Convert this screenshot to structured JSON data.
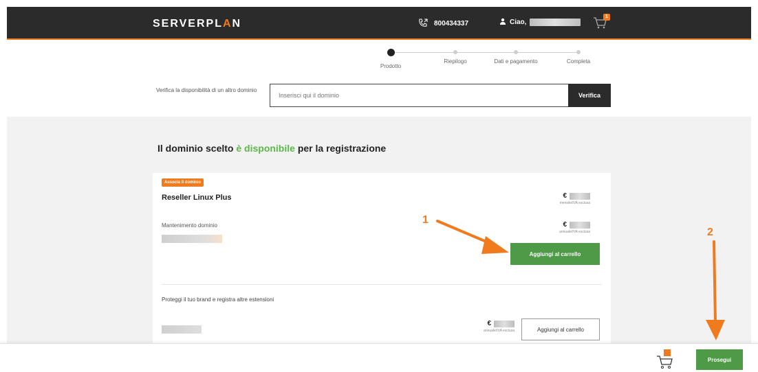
{
  "header": {
    "logo": {
      "part1": "SERVER",
      "part2": "PL",
      "part3": "A",
      "part4": "N"
    },
    "phone": "800434337",
    "greeting": "Ciao,",
    "cart_count": "1",
    "accent": "#f07b1e",
    "bg": "#2b2b2b"
  },
  "stepper": {
    "steps": [
      {
        "label": "Prodotto",
        "active": true
      },
      {
        "label": "Riepilogo",
        "active": false
      },
      {
        "label": "Dati e pagamento",
        "active": false
      },
      {
        "label": "Completa",
        "active": false
      }
    ]
  },
  "verify": {
    "label": "Verifica la disponibilità di un altro dominio",
    "placeholder": "Inserisci qui il dominio",
    "button": "Verifica"
  },
  "main": {
    "headline_pre": "Il dominio scelto ",
    "headline_highlight": "è disponibile",
    "headline_post": " per la registrazione",
    "card": {
      "tag": "Associa il dominio",
      "product_name": "Reseller Linux Plus",
      "product_price_sub": "mensile/IVA esclusa",
      "maintenance_label": "Mantenimento dominio",
      "maintenance_price_sub": "annuale/IVA esclusa",
      "add_button": "Aggiungi al carrello",
      "protect_text": "Proteggi il tuo brand e registra altre estensioni",
      "ext_price_sub": "annuale/IVA esclusa",
      "ext_add_button": "Aggiungi al carrello",
      "currency": "€"
    }
  },
  "annotations": {
    "one": "1",
    "two": "2"
  },
  "footer": {
    "proceed_button": "Prosegui"
  },
  "colors": {
    "green": "#4e9a47",
    "highlight_green": "#5bb84a",
    "orange": "#f07b1e"
  }
}
